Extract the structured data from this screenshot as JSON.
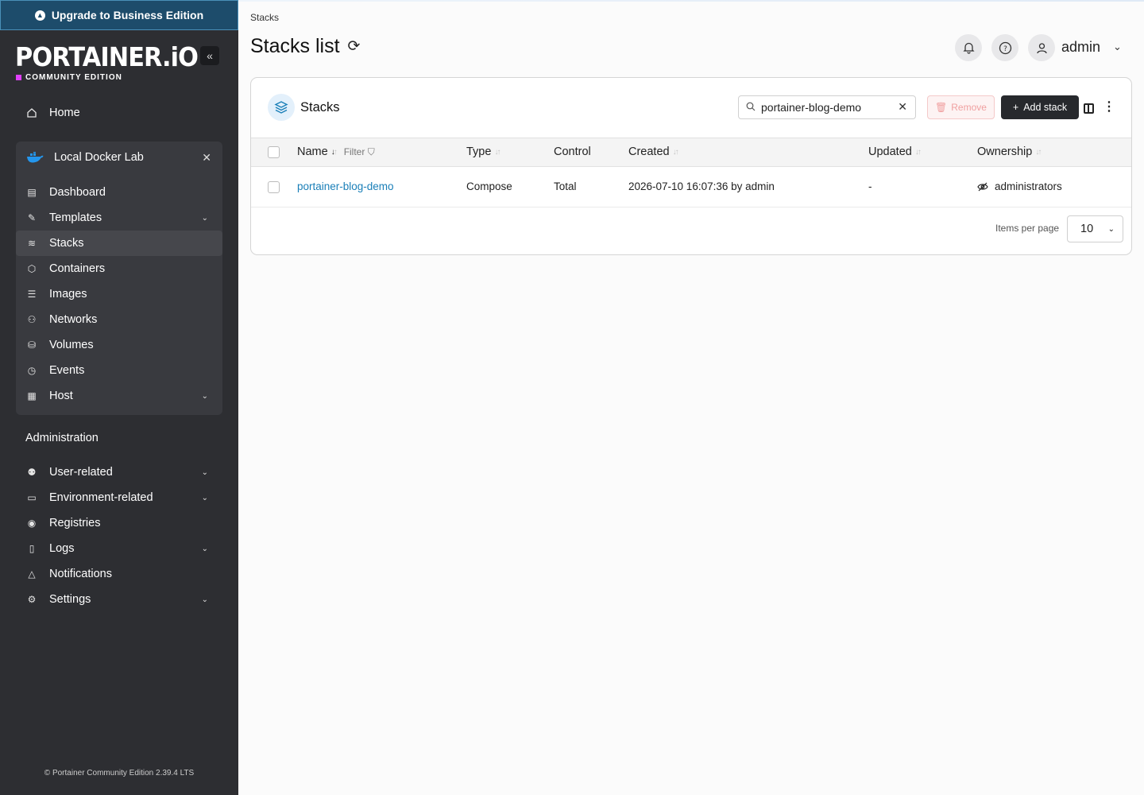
{
  "upgrade_banner": {
    "label": "Upgrade to Business Edition"
  },
  "logo": {
    "text": "PORTAINER.iO",
    "edition": "COMMUNITY EDITION"
  },
  "nav": {
    "home": "Home"
  },
  "environment": {
    "name": "Local Docker Lab",
    "items": [
      {
        "label": "Dashboard",
        "icon": "dashboard-icon",
        "expandable": false
      },
      {
        "label": "Templates",
        "icon": "templates-icon",
        "expandable": true
      },
      {
        "label": "Stacks",
        "icon": "stacks-icon",
        "expandable": false,
        "active": true
      },
      {
        "label": "Containers",
        "icon": "containers-icon",
        "expandable": false
      },
      {
        "label": "Images",
        "icon": "images-icon",
        "expandable": false
      },
      {
        "label": "Networks",
        "icon": "networks-icon",
        "expandable": false
      },
      {
        "label": "Volumes",
        "icon": "volumes-icon",
        "expandable": false
      },
      {
        "label": "Events",
        "icon": "events-icon",
        "expandable": false
      },
      {
        "label": "Host",
        "icon": "host-icon",
        "expandable": true
      }
    ]
  },
  "administration": {
    "heading": "Administration",
    "items": [
      {
        "label": "User-related",
        "icon": "users-icon",
        "expandable": true
      },
      {
        "label": "Environment-related",
        "icon": "environment-icon",
        "expandable": true
      },
      {
        "label": "Registries",
        "icon": "registries-icon",
        "expandable": false
      },
      {
        "label": "Logs",
        "icon": "logs-icon",
        "expandable": true
      },
      {
        "label": "Notifications",
        "icon": "bell-icon",
        "expandable": false
      },
      {
        "label": "Settings",
        "icon": "settings-icon",
        "expandable": true
      }
    ]
  },
  "footer": {
    "text": "Portainer Community Edition 2.39.4 LTS"
  },
  "breadcrumb": "Stacks",
  "page_title": "Stacks list",
  "user": {
    "name": "admin"
  },
  "panel": {
    "title": "Stacks",
    "search_value": "portainer-blog-demo",
    "remove_label": "Remove",
    "add_label": "Add stack"
  },
  "table": {
    "headers": {
      "name": "Name",
      "filter": "Filter",
      "type": "Type",
      "control": "Control",
      "created": "Created",
      "updated": "Updated",
      "ownership": "Ownership"
    },
    "rows": [
      {
        "name": "portainer-blog-demo",
        "type": "Compose",
        "control": "Total",
        "created": "2026-07-10 16:07:36 by admin",
        "updated": "-",
        "ownership": "administrators"
      }
    ]
  },
  "pagination": {
    "items_per_page_label": "Items per page",
    "items_per_page": "10"
  },
  "colors": {
    "sidebar_bg": "#2d2e32",
    "banner_bg": "#1d4c6b",
    "link": "#1a7fb8",
    "edition_accent": "#e040fb",
    "add_button": "#27292d"
  }
}
